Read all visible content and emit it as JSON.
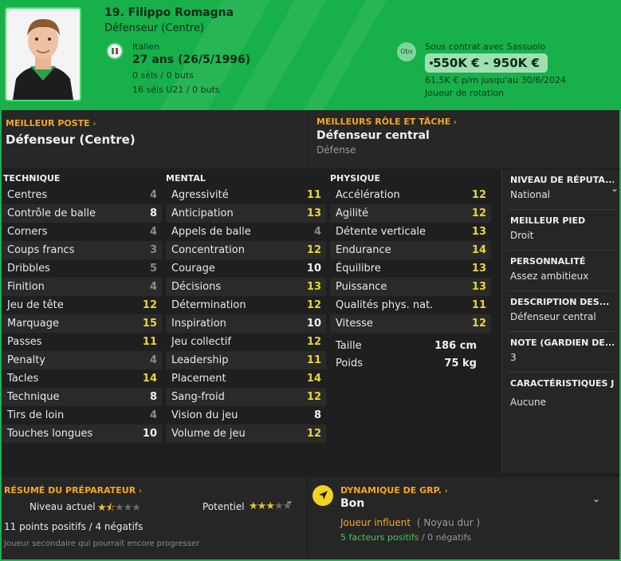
{
  "header": {
    "name": "19. Filippo Romagna",
    "position": "Défenseur (Centre)",
    "nationality": "Italien",
    "age": "27 ans (26/5/1996)",
    "caps": "0 séls / 0 buts",
    "u21": "16 séls U21 / 0 buts",
    "obs_label": "Obs",
    "contract": "Sous contrat avec Sassuolo",
    "value": "550K € - 950K €",
    "wage": "61,5K € p/m jusqu'au 30/6/2024",
    "role": "Joueur de rotation"
  },
  "best_position": {
    "label": "MEILLEUR POSTE",
    "value": "Défenseur (Centre)"
  },
  "best_role": {
    "label": "MEILLEURS RÔLE ET TÂCHE",
    "value": "Défenseur central",
    "duty": "Défense"
  },
  "technical": {
    "title": "TECHNIQUE",
    "rows": [
      {
        "name": "Centres",
        "value": "4"
      },
      {
        "name": "Contrôle de balle",
        "value": "8"
      },
      {
        "name": "Corners",
        "value": "4"
      },
      {
        "name": "Coups francs",
        "value": "3"
      },
      {
        "name": "Dribbles",
        "value": "5"
      },
      {
        "name": "Finition",
        "value": "4"
      },
      {
        "name": "Jeu de tête",
        "value": "12"
      },
      {
        "name": "Marquage",
        "value": "15"
      },
      {
        "name": "Passes",
        "value": "11"
      },
      {
        "name": "Penalty",
        "value": "4"
      },
      {
        "name": "Tacles",
        "value": "14"
      },
      {
        "name": "Technique",
        "value": "8"
      },
      {
        "name": "Tirs de loin",
        "value": "4"
      },
      {
        "name": "Touches longues",
        "value": "10"
      }
    ]
  },
  "mental": {
    "title": "MENTAL",
    "rows": [
      {
        "name": "Agressivité",
        "value": "11"
      },
      {
        "name": "Anticipation",
        "value": "13"
      },
      {
        "name": "Appels de balle",
        "value": "4"
      },
      {
        "name": "Concentration",
        "value": "12"
      },
      {
        "name": "Courage",
        "value": "10"
      },
      {
        "name": "Décisions",
        "value": "13"
      },
      {
        "name": "Détermination",
        "value": "12"
      },
      {
        "name": "Inspiration",
        "value": "10"
      },
      {
        "name": "Jeu collectif",
        "value": "12"
      },
      {
        "name": "Leadership",
        "value": "11"
      },
      {
        "name": "Placement",
        "value": "14"
      },
      {
        "name": "Sang-froid",
        "value": "12"
      },
      {
        "name": "Vision du jeu",
        "value": "8"
      },
      {
        "name": "Volume de jeu",
        "value": "12"
      }
    ]
  },
  "physical": {
    "title": "PHYSIQUE",
    "rows": [
      {
        "name": "Accélération",
        "value": "12"
      },
      {
        "name": "Agilité",
        "value": "12"
      },
      {
        "name": "Détente verticale",
        "value": "13"
      },
      {
        "name": "Endurance",
        "value": "14"
      },
      {
        "name": "Équilibre",
        "value": "13"
      },
      {
        "name": "Puissance",
        "value": "13"
      },
      {
        "name": "Qualités phys. nat.",
        "value": "11"
      },
      {
        "name": "Vitesse",
        "value": "12"
      }
    ],
    "height_label": "Taille",
    "height": "186 cm",
    "weight_label": "Poids",
    "weight": "75 kg"
  },
  "info": [
    {
      "label": "NIVEAU DE RÉPUTA...",
      "value": "National"
    },
    {
      "label": "MEILLEUR PIED",
      "value": "Droit"
    },
    {
      "label": "PERSONNALITÉ",
      "value": "Assez ambitieux"
    },
    {
      "label": "DESCRIPTION DES...",
      "value": "Défenseur central"
    },
    {
      "label": "NOTE (GARDIEN DE...",
      "value": "3"
    },
    {
      "label": "CARACTÉRISTIQUES J",
      "value": "Aucune"
    }
  ],
  "coach": {
    "title": "RÉSUMÉ DU PRÉPARATEUR",
    "current_label": "Niveau actuel",
    "current_stars": 1.5,
    "potential_label": "Potentiel",
    "potential_stars": 3,
    "points": "11 points positifs / 4 négatifs",
    "note": "Joueur secondaire qui pourrait encore progresser"
  },
  "dynamics": {
    "title": "DYNAMIQUE DE GRP.",
    "value": "Bon",
    "influence": "Joueur influent",
    "group": "( Noyau dur )",
    "positive": "5 facteurs positifs",
    "negative": "0 négatifs"
  },
  "colors": {
    "accent_green": "#17b04a",
    "orange": "#f5a623",
    "yellow": "#e9d43a"
  }
}
